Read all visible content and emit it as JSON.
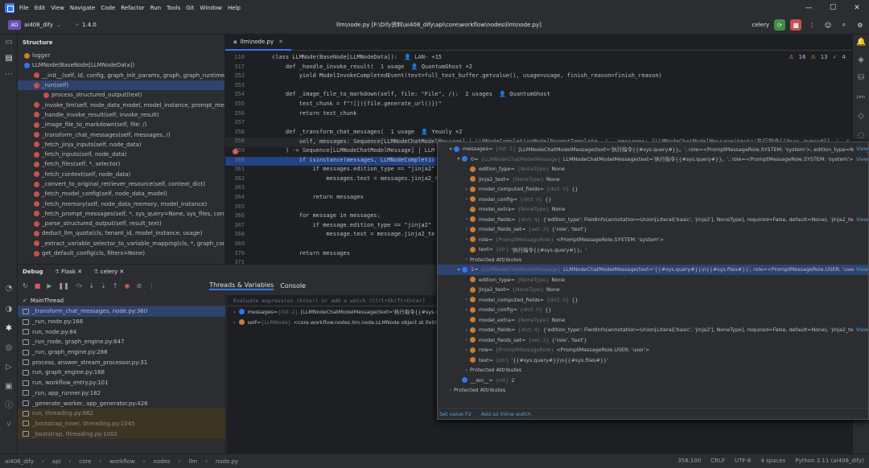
{
  "menu": [
    "File",
    "Edit",
    "View",
    "Navigate",
    "Code",
    "Refactor",
    "Run",
    "Tools",
    "Git",
    "Window",
    "Help"
  ],
  "toolbar": {
    "project_badge": "AD",
    "project_name": "ai408_dify",
    "version": "1.4.0",
    "file_path": "llm\\node.py [F:\\Dify资料\\ai408_dify\\api\\core\\workflow\\nodes\\llm\\node.py]",
    "run_config": "celery"
  },
  "structure": {
    "title": "Structure",
    "items": [
      "logger",
      "LLMNode(BaseNode[LLMNodeData])",
      "__init__(self, id, config, graph_init_params, graph, graph_runtime_state, pr",
      "_run(self)",
      "process_structured_output(text)",
      "_invoke_llm(self, node_data_model, model_instance, prompt_messages, s",
      "_handle_invoke_result(self, invoke_result)",
      "_image_file_to_markdown(self, file: /)",
      "_transform_chat_messages(self, messages, /)",
      "_fetch_jinja_inputs(self, node_data)",
      "_fetch_inputs(self, node_data)",
      "_fetch_files(self, *, selector)",
      "_fetch_context(self, node_data)",
      "_convert_to_original_retriever_resource(self, context_dict)",
      "_fetch_model_config(self, node_data_model)",
      "_fetch_memory(self, node_data_memory, model_instance)",
      "_fetch_prompt_messages(self, *, sys_query=None, sys_files, context=Non",
      "_parse_structured_output(self, result_text)",
      "deduct_llm_quota(cls, tenant_id, model_instance, usage)",
      "_extract_variable_selector_to_variable_mapping(cls, *, graph_config, nod",
      "get_default_config(cls, filters=None)"
    ]
  },
  "editor": {
    "tab": "llm\\node.py",
    "inspections": {
      "warnings": "16",
      "weak": "13",
      "typos": "4"
    },
    "lines": [
      {
        "n": "110",
        "code": "class LLMNode(BaseNode[LLMNodeData]):  👤 LAN- +15"
      },
      {
        "n": "317",
        "code": "    def _handle_invoke_result(  1 usage  👤 QuantumGhost +2"
      },
      {
        "n": "352",
        "code": "        yield ModelInvokeCompletedEvent(text=full_text_buffer.getvalue(), usage=usage, finish_reason=finish_reason)"
      },
      {
        "n": "353",
        "code": ""
      },
      {
        "n": "354",
        "code": "    def _image_file_to_markdown(self, file: \"File\", /):  2 usages  👤 QuantumGhost"
      },
      {
        "n": "355",
        "code": "        text_chunk = f\"![]({file.generate_url()})\""
      },
      {
        "n": "356",
        "code": "        return text_chunk"
      },
      {
        "n": "357",
        "code": ""
      },
      {
        "n": "358",
        "code": "    def _transform_chat_messages(  1 usage  👤 Yeuoly +2"
      },
      {
        "n": "358",
        "code": "        self, messages: Sequence[LLMNodeChatModelMessage] | LLMNodeCompletionModelPromptTemplate, /   messages: [LLMNodeChatModelMessage(text='执行指令{{#sys.query#}}。', r"
      },
      {
        "n": "359",
        "code": "    ) -> Sequence[LLMNodeChatModelMessage] | LLM"
      },
      {
        "n": "360",
        "code": "        if isinstance(messages, LLMNodeCompletio"
      },
      {
        "n": "361",
        "code": "            if messages.edition_type == \"jinja2\""
      },
      {
        "n": "362",
        "code": "                messages.text = messages.jinja2_t"
      },
      {
        "n": "363",
        "code": ""
      },
      {
        "n": "364",
        "code": "            return messages"
      },
      {
        "n": "365",
        "code": ""
      },
      {
        "n": "366",
        "code": "        for message in messages:"
      },
      {
        "n": "367",
        "code": "            if message.edition_type == \"jinja2\""
      },
      {
        "n": "368",
        "code": "                message.text = message.jinja2_te"
      },
      {
        "n": "369",
        "code": ""
      },
      {
        "n": "370",
        "code": "        return messages"
      },
      {
        "n": "371",
        "code": ""
      }
    ]
  },
  "debug": {
    "title": "Debug",
    "tabs": [
      "Flask",
      "celery"
    ],
    "sub_tabs": [
      "Threads & Variables",
      "Console"
    ],
    "thread": "MainThread",
    "evaluate_placeholder": "Evaluate expression (Enter) or add a watch (Ctrl+Shift+Enter)",
    "frames": [
      "_transform_chat_messages, node.py:360",
      "_run, node.py:166",
      "run, node.py:84",
      "_run_node, graph_engine.py:647",
      "_run, graph_engine.py:288",
      "process, answer_stream_processor.py:31",
      "run, graph_engine.py:166",
      "run, workflow_entry.py:101",
      "_run, app_runner.py:182",
      "_generate_worker, app_generator.py:426",
      "run, threading.py:982",
      "_bootstrap_inner, threading.py:1045",
      "_bootstrap, threading.py:1002"
    ],
    "variables": [
      {
        "name": "messages",
        "type": "{list: 2}",
        "value": "[LLMNodeChatModelMessage(text='执行指令{{#sys.qu"
      },
      {
        "name": "self",
        "type": "{LLMNode}",
        "value": "<core.workflow.nodes.llm.node.LLMNode object at 0x0C"
      }
    ]
  },
  "popup": {
    "rows": [
      {
        "indent": 0,
        "arrow": "▾",
        "key": "messages",
        "type": "{list: 2}",
        "val": "[LLMNodeChatModelMessage(text='执行指令{{#sys.query#}}。', role=<PromptMessageRole.SYSTEM: 'system'>, edition_type=None, jinja2_",
        "view": "View"
      },
      {
        "indent": 1,
        "arrow": "▾",
        "key": "0",
        "type": "{LLMNodeChatModelMessage}",
        "val": "LLMNodeChatModelMessage(text='执行指令{{#sys.query#}}。', role=<PromptMessageRole.SYSTEM: 'system'>, edition_...",
        "view": "View"
      },
      {
        "indent": 2,
        "arrow": "",
        "key": "edition_type",
        "type": "{NoneType}",
        "val": "None",
        "view": ""
      },
      {
        "indent": 2,
        "arrow": "",
        "key": "jinja2_text",
        "type": "{NoneType}",
        "val": "None",
        "view": ""
      },
      {
        "indent": 2,
        "arrow": "›",
        "key": "model_computed_fields",
        "type": "{dict: 0}",
        "val": "{}",
        "view": ""
      },
      {
        "indent": 2,
        "arrow": "›",
        "key": "model_config",
        "type": "{dict: 0}",
        "val": "{}",
        "view": ""
      },
      {
        "indent": 2,
        "arrow": "",
        "key": "model_extra",
        "type": "{NoneType}",
        "val": "None",
        "view": ""
      },
      {
        "indent": 2,
        "arrow": "›",
        "key": "model_fields",
        "type": "{dict: 4}",
        "val": "{'edition_type': FieldInfo(annotation=Union[Literal['basic', 'jinja2'], NoneType], required=False, default=None), 'jinja2_text': FieldIn...",
        "view": "View"
      },
      {
        "indent": 2,
        "arrow": "›",
        "key": "model_fields_set",
        "type": "{set: 2}",
        "val": "{'role', 'text'}",
        "view": ""
      },
      {
        "indent": 2,
        "arrow": "›",
        "key": "role",
        "type": "{PromptMessageRole}",
        "val": "<PromptMessageRole.SYSTEM: 'system'>",
        "view": ""
      },
      {
        "indent": 2,
        "arrow": "",
        "key": "text",
        "type": "{str}",
        "val": "'执行指令{{#sys.query#}}。'",
        "view": ""
      },
      {
        "indent": 2,
        "arrow": "›",
        "key": "Protected Attributes",
        "type": "",
        "val": "",
        "view": ""
      },
      {
        "indent": 1,
        "arrow": "▾",
        "key": "1",
        "type": "{LLMNodeChatModelMessage}",
        "val": "LLMNodeChatModelMessage(text='{{#sys.query#}}\\n{{#sys.files#}}', role=<PromptMessageRole.USER: 'user'>, edition_t...",
        "view": "View"
      },
      {
        "indent": 2,
        "arrow": "",
        "key": "edition_type",
        "type": "{NoneType}",
        "val": "None",
        "view": ""
      },
      {
        "indent": 2,
        "arrow": "",
        "key": "jinja2_text",
        "type": "{NoneType}",
        "val": "None",
        "view": ""
      },
      {
        "indent": 2,
        "arrow": "›",
        "key": "model_computed_fields",
        "type": "{dict: 0}",
        "val": "{}",
        "view": ""
      },
      {
        "indent": 2,
        "arrow": "›",
        "key": "model_config",
        "type": "{dict: 0}",
        "val": "{}",
        "view": ""
      },
      {
        "indent": 2,
        "arrow": "",
        "key": "model_extra",
        "type": "{NoneType}",
        "val": "None",
        "view": ""
      },
      {
        "indent": 2,
        "arrow": "›",
        "key": "model_fields",
        "type": "{dict: 4}",
        "val": "{'edition_type': FieldInfo(annotation=Union[Literal['basic', 'jinja2'], NoneType], required=False, default=None), 'jinja2_text': FieldIn...",
        "view": "View"
      },
      {
        "indent": 2,
        "arrow": "›",
        "key": "model_fields_set",
        "type": "{set: 2}",
        "val": "{'role', 'text'}",
        "view": ""
      },
      {
        "indent": 2,
        "arrow": "›",
        "key": "role",
        "type": "{PromptMessageRole}",
        "val": "<PromptMessageRole.USER: 'user'>",
        "view": ""
      },
      {
        "indent": 2,
        "arrow": "",
        "key": "text",
        "type": "{str}",
        "val": "'{{#sys.query#}}\\n{{#sys.files#}}'",
        "view": ""
      },
      {
        "indent": 2,
        "arrow": "›",
        "key": "Protected Attributes",
        "type": "",
        "val": "",
        "view": ""
      },
      {
        "indent": 1,
        "arrow": "",
        "key": "__len__",
        "type": "{int}",
        "val": "2",
        "view": ""
      },
      {
        "indent": 0,
        "arrow": "›",
        "key": "Protected Attributes",
        "type": "",
        "val": "",
        "view": ""
      }
    ],
    "footer": [
      "Set value  F2",
      "Add as inline watch"
    ]
  },
  "status": {
    "breadcrumbs": [
      "ai408_dify",
      "api",
      "core",
      "workflow",
      "nodes",
      "llm",
      "node.py"
    ],
    "position": "358:100",
    "line_ending": "CRLF",
    "encoding": "UTF-8",
    "indent": "4 spaces",
    "interpreter": "Python 3.11 (ai408_dify)"
  },
  "colors": {
    "accent": "#3574f0",
    "selection": "#2e436e",
    "background": "#1e1f22",
    "panel": "#2b2d30"
  }
}
